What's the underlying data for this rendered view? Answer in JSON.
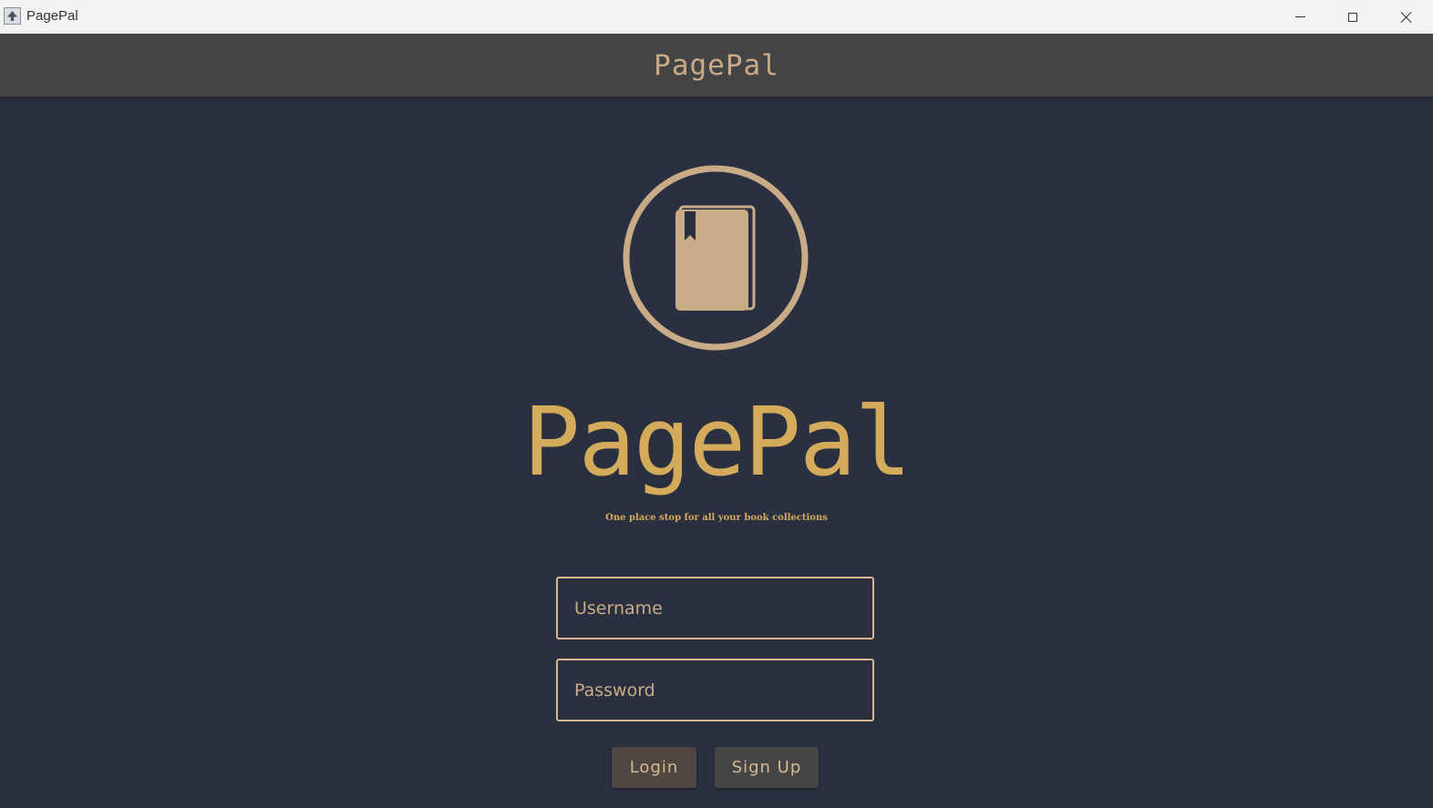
{
  "window": {
    "title": "PagePal",
    "controls": {
      "minimize": "minimize",
      "maximize": "maximize",
      "close": "close"
    }
  },
  "header": {
    "title": "PagePal"
  },
  "brand": {
    "name": "PagePal",
    "tagline": "One place stop for all your book collections"
  },
  "login_form": {
    "username_placeholder": "Username",
    "username_value": "",
    "password_placeholder": "Password",
    "password_value": "",
    "login_label": "Login",
    "signup_label": "Sign Up"
  },
  "colors": {
    "background": "#2a3040",
    "header": "#444444",
    "accent": "#d6b993",
    "brand_gold": "#d4ab5a"
  },
  "icons": {
    "app": "app-icon",
    "logo": "book-icon"
  }
}
